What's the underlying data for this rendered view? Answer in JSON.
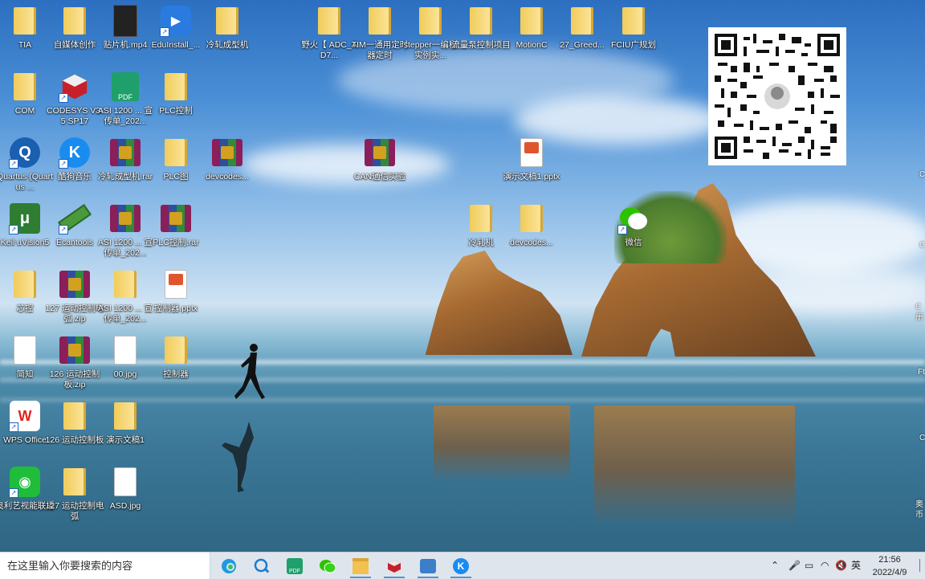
{
  "desktop_icons": [
    {
      "label": "TIA",
      "type": "folder"
    },
    {
      "label": "自媒体创作",
      "type": "folder"
    },
    {
      "label": "贴片机.mp4",
      "type": "video"
    },
    {
      "label": "EduInstall_...",
      "type": "app"
    },
    {
      "label": "冷轧成型机",
      "type": "folder"
    },
    {
      "label": "野火【 ADC_AD7...",
      "type": "folder"
    },
    {
      "label": "TIM一通用定时器定时",
      "type": "folder"
    },
    {
      "label": "stepper一编程实例实...",
      "type": "folder"
    },
    {
      "label": "流量泵控制项目",
      "type": "folder"
    },
    {
      "label": "MotionC",
      "type": "folder"
    },
    {
      "label": "27_Greed...",
      "type": "folder"
    },
    {
      "label": "FCIU广规划",
      "type": "folder"
    },
    {
      "label": "COM",
      "type": "folder"
    },
    {
      "label": "CODESYS V3.5 SP17",
      "type": "app"
    },
    {
      "label": "ASI 1200 ... 宣传单_202...",
      "type": "pdf"
    },
    {
      "label": "PLC控制",
      "type": "folder"
    },
    {
      "label": "Quartus (Quartus ...",
      "type": "app"
    },
    {
      "label": "酷狗音乐",
      "type": "app"
    },
    {
      "label": "冷轧成型机.rar",
      "type": "zip"
    },
    {
      "label": "PLC图",
      "type": "folder"
    },
    {
      "label": "devcodes...",
      "type": "zip"
    },
    {
      "label": "CAN通信实验",
      "type": "zip"
    },
    {
      "label": "演示文稿1.pptx",
      "type": "pptx"
    },
    {
      "label": "Keil uVision5",
      "type": "app"
    },
    {
      "label": "Ecantools",
      "type": "app"
    },
    {
      "label": "ASI 1200 ... 宣传单_202...",
      "type": "zip"
    },
    {
      "label": "PLC控制.rar",
      "type": "zip"
    },
    {
      "label": "冷轧机",
      "type": "folder"
    },
    {
      "label": "devcodes...",
      "type": "folder"
    },
    {
      "label": "微信",
      "type": "app"
    },
    {
      "label": "芯控",
      "type": "folder"
    },
    {
      "label": "127 运动控制电弧.zip",
      "type": "zip"
    },
    {
      "label": "ASI 1200 ... 宣传单_202...",
      "type": "folder"
    },
    {
      "label": "控制器.pptx",
      "type": "pptx"
    },
    {
      "label": "简知",
      "type": "file"
    },
    {
      "label": "126 运动控制板.zip",
      "type": "zip"
    },
    {
      "label": "00.jpg",
      "type": "file"
    },
    {
      "label": "控制器",
      "type": "folder"
    },
    {
      "label": "WPS Office",
      "type": "app"
    },
    {
      "label": "126 运动控制板",
      "type": "folder"
    },
    {
      "label": "演示文稿1",
      "type": "folder"
    },
    {
      "label": "奥利艺视能联播",
      "type": "app"
    },
    {
      "label": "127 运动控制电弧",
      "type": "folder"
    },
    {
      "label": "ASD.jpg",
      "type": "file"
    }
  ],
  "edge_labels": [
    "C",
    "C",
    "C 册",
    "Ft",
    "C",
    "奥 币"
  ],
  "taskbar": {
    "search_placeholder": "在这里输入你要搜索的内容",
    "apps": [
      "edge-icon",
      "browser-icon",
      "pdf-icon",
      "wechat-icon",
      "explorer-icon",
      "codesys-icon",
      "network-icon",
      "kugou-icon"
    ],
    "tray": {
      "ime": "英",
      "time": "21:56",
      "date": "2022/4/9"
    }
  },
  "colors": {
    "accent": "#5a8fd0",
    "taskbar": "#dfe5ec"
  }
}
